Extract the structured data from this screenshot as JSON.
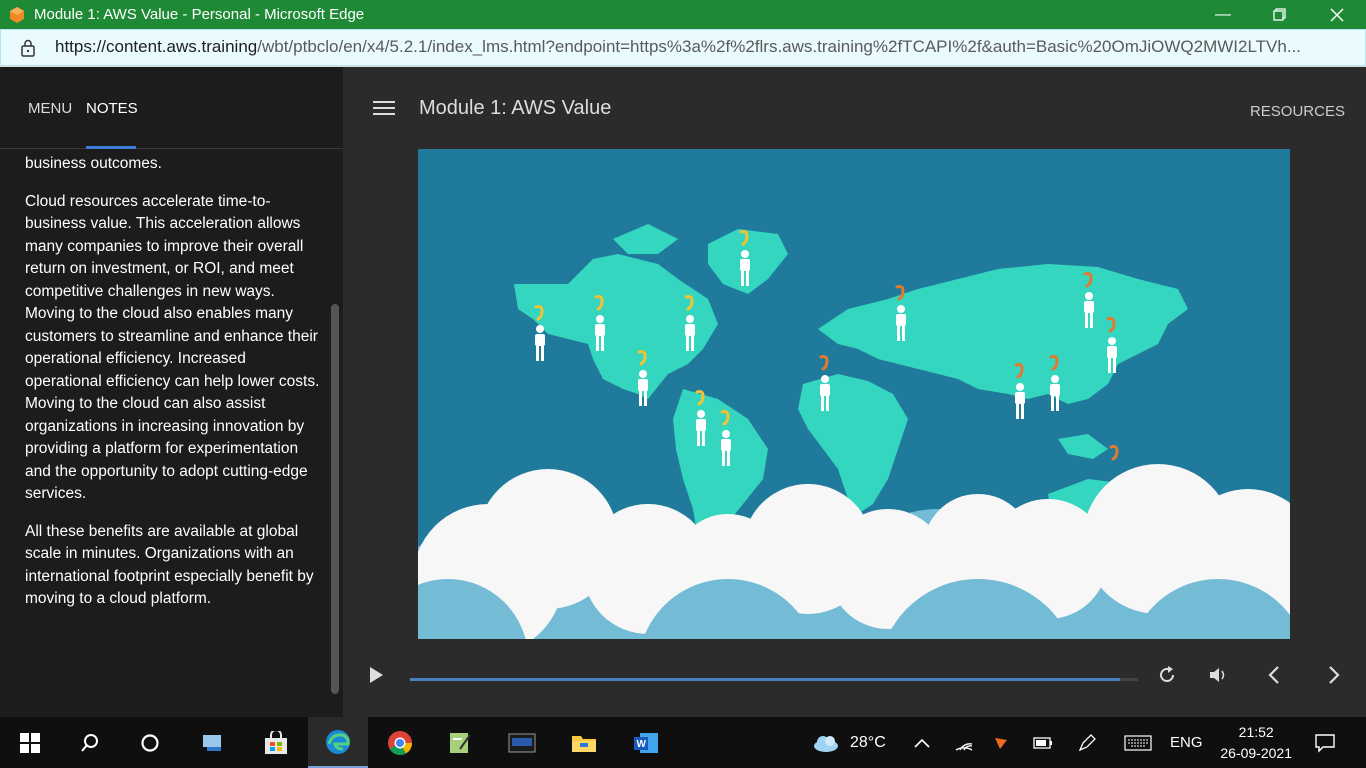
{
  "window": {
    "title": "Module 1: AWS Value - Personal - Microsoft Edge",
    "controls": [
      "minimize-icon",
      "restore-icon",
      "close-icon"
    ]
  },
  "address": {
    "url_host": "https://content.aws.training",
    "url_path": "/wbt/ptbclo/en/x4/5.2.1/index_lms.html?endpoint=https%3a%2f%2flrs.aws.training%2fTCAPI%2f&auth=Basic%20OmJiOWQ2MWI2LTVh..."
  },
  "sidebar": {
    "tabs": [
      {
        "label": "MENU"
      },
      {
        "label": "NOTES"
      }
    ],
    "notes": [
      "business outcomes.",
      "Cloud resources accelerate time-to-business value. This acceleration allows many companies to improve their overall return on investment, or ROI, and meet competitive challenges in new ways. Moving to the cloud also enables many customers to streamline and enhance their operational efficiency. Increased operational efficiency can help lower costs. Moving to the cloud can also assist organizations in increasing innovation by providing a platform for experimentation and the opportunity to adopt cutting-edge services.",
      "All these benefits are available at global scale in minutes. Organizations with an international footprint especially benefit by moving to a cloud platform."
    ]
  },
  "main": {
    "module_title": "Module 1: AWS Value",
    "resources_label": "RESOURCES",
    "progress": 0.975
  },
  "colors": {
    "titlebar": "#1f8a35",
    "ocean": "#1f7a9c",
    "land": "#35d6bf",
    "footprint_yellow": "#f2c230",
    "footprint_orange": "#e07a30"
  },
  "taskbar": {
    "weather": "28°C",
    "lang": "ENG",
    "time": "21:52",
    "date": "26-09-2021"
  }
}
